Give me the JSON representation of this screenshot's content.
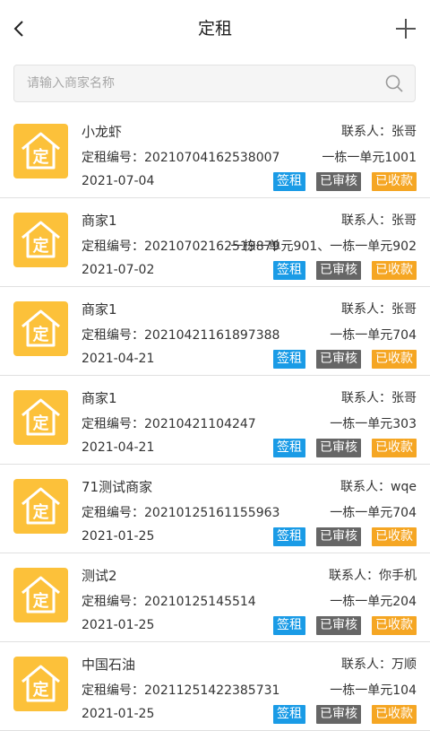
{
  "header": {
    "title": "定租",
    "back_icon": "chevron-left-icon",
    "add_icon": "plus-icon"
  },
  "search": {
    "placeholder": "请输入商家名称",
    "value": "",
    "icon": "search-icon"
  },
  "colors": {
    "icon_bg": "#fcc13a",
    "sign_tag": "#1a9be6",
    "review_tag": "#666666",
    "paid_tag": "#f5a623"
  },
  "tags": {
    "sign": "签租",
    "review": "已审核",
    "paid": "已收款"
  },
  "items": [
    {
      "name": "小龙虾",
      "contact": "联系人：张哥",
      "code": "定租编号：20210704162538007",
      "unit": "一栋一单元1001",
      "date": "2021-07-04"
    },
    {
      "name": "商家1",
      "contact": "联系人：张哥",
      "code": "定租编号：20210702162519879",
      "unit": "一栋一单元901、一栋一单元902",
      "date": "2021-07-02"
    },
    {
      "name": "商家1",
      "contact": "联系人：张哥",
      "code": "定租编号：20210421161897388",
      "unit": "一栋一单元704",
      "date": "2021-04-21"
    },
    {
      "name": "商家1",
      "contact": "联系人：张哥",
      "code": "定租编号：20210421104247",
      "unit": "一栋一单元303",
      "date": "2021-04-21"
    },
    {
      "name": "71测试商家",
      "contact": "联系人：wqe",
      "code": "定租编号：20210125161155963",
      "unit": "一栋一单元704",
      "date": "2021-01-25"
    },
    {
      "name": "测试2",
      "contact": "联系人：你手机",
      "code": "定租编号：20210125145514",
      "unit": "一栋一单元204",
      "date": "2021-01-25"
    },
    {
      "name": "中国石油",
      "contact": "联系人：万顺",
      "code": "定租编号：20211251422385731",
      "unit": "一栋一单元104",
      "date": "2021-01-25"
    }
  ]
}
